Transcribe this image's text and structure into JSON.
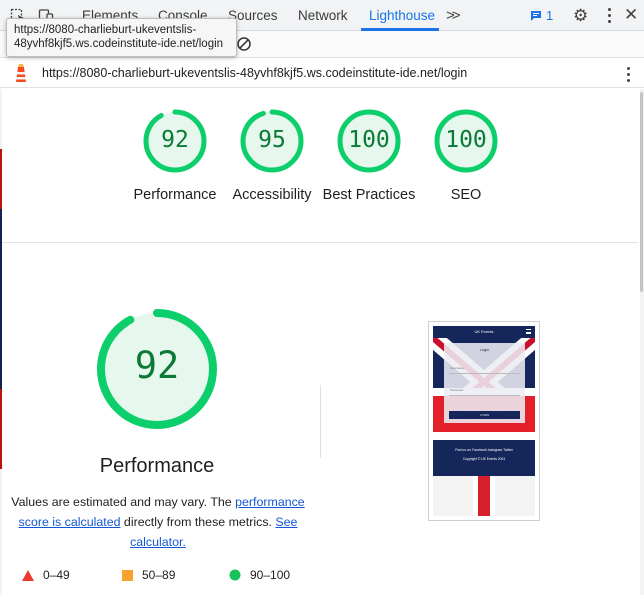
{
  "devtools": {
    "tabs": [
      {
        "label": "Elements"
      },
      {
        "label": "Console"
      },
      {
        "label": "Sources"
      },
      {
        "label": "Network"
      },
      {
        "label": "Lighthouse"
      }
    ],
    "active_tab": "Lighthouse",
    "issues_count": "1",
    "icons": [
      "inspect-element-icon",
      "device-toolbar-icon",
      "more-tabs-icon",
      "issues-icon",
      "settings-gear-icon",
      "more-options-icon",
      "close-icon",
      "clear-icon",
      "lighthouse-logo-icon"
    ]
  },
  "tooltip": {
    "text": "https://8080-charlieburt-ukeventslis-48yvhf8kjf5.ws.codeinstitute-ide.net/login"
  },
  "url_bar": {
    "url": "https://8080-charlieburt-ukeventslis-48yvhf8kjf5.ws.codeinstitute-ide.net/login"
  },
  "scores": [
    {
      "value": "92",
      "score": 0.92,
      "label": "Performance"
    },
    {
      "value": "95",
      "score": 0.95,
      "label": "Accessibility"
    },
    {
      "value": "100",
      "score": 1.0,
      "label": "Best Practices"
    },
    {
      "value": "100",
      "score": 1.0,
      "label": "SEO"
    }
  ],
  "performance": {
    "score": "92",
    "score_fraction": 0.92,
    "title": "Performance",
    "note_prefix": "Values are estimated and may vary. The ",
    "note_link": "performance score is calculated",
    "note_middle": " directly from these metrics. ",
    "note_link2": "See calculator."
  },
  "legend": [
    {
      "range": "0–49",
      "color": "#eb3a33",
      "shape": "triangle"
    },
    {
      "range": "50–89",
      "color": "#f7a12f",
      "shape": "square"
    },
    {
      "range": "90–100",
      "color": "#18c25a",
      "shape": "circle"
    }
  ],
  "screenshot": {
    "brand": "UK Events",
    "login_title": "Login",
    "username_label": "Username",
    "password_label": "Password",
    "login_button": "LOGIN",
    "signup_text": "New Here?? Set up an account!",
    "find_text": "Find us on: Facebook Instagram Twitter",
    "copyright": "Copyright © UK Events 2024"
  },
  "colors": {
    "accent": "#1a73e8",
    "pass_green": "#0cce6b",
    "pass_text": "#0b7a35",
    "gauge_fill": "#e6f7ed",
    "link": "#1558d6"
  }
}
